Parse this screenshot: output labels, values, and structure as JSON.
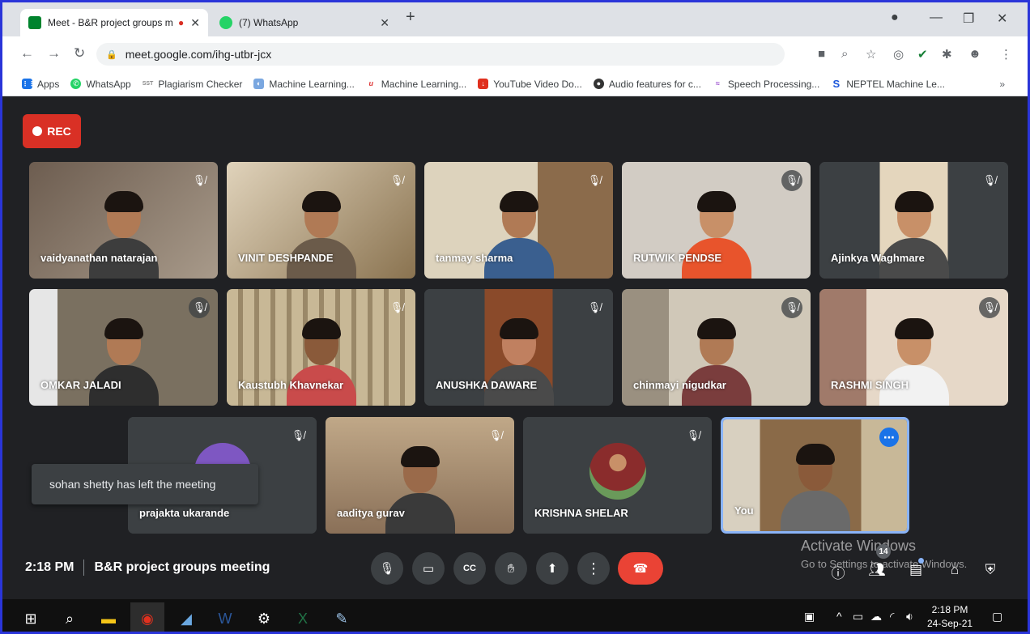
{
  "browser": {
    "tabs": [
      {
        "title": "Meet - B&R project groups m",
        "recording_dot": "●",
        "close": "✕"
      },
      {
        "title": "(7) WhatsApp",
        "close": "✕"
      }
    ],
    "new_tab": "+",
    "address": "meet.google.com/ihg-utbr-jcx",
    "bookmarks": [
      {
        "label": "Apps",
        "icon": "apps-grid-icon",
        "color": "#1a73e8",
        "glyph": "⋮⋮"
      },
      {
        "label": "WhatsApp",
        "icon": "whatsapp-icon",
        "color": "#25d366",
        "glyph": "✆"
      },
      {
        "label": "Plagiarism Checker",
        "icon": "sst-icon",
        "color": "#888888",
        "glyph": "SST"
      },
      {
        "label": "Machine Learning...",
        "icon": "ml-icon",
        "color": "#7aa7e0",
        "glyph": "◐"
      },
      {
        "label": "Machine Learning...",
        "icon": "udemy-icon",
        "color": "#d33",
        "glyph": "u"
      },
      {
        "label": "YouTube Video Do...",
        "icon": "download-icon",
        "color": "#e0301e",
        "glyph": "↓"
      },
      {
        "label": "Audio features for c...",
        "icon": "github-icon",
        "color": "#333333",
        "glyph": "●"
      },
      {
        "label": "Speech Processing...",
        "icon": "speech-icon",
        "color": "#9c4fcf",
        "glyph": "≈"
      },
      {
        "label": "NEPTEL Machine Le...",
        "icon": "s-icon",
        "color": "#1a56db",
        "glyph": "S"
      }
    ],
    "bookmarks_more": "»"
  },
  "meet": {
    "rec_label": "REC",
    "tiles_row1": [
      {
        "name": "vaidyanathan natarajan",
        "bg": "#7a6a5a",
        "shirt": "#3d3d3d"
      },
      {
        "name": "VINIT DESHPANDE",
        "bg": "#c9b79a",
        "shirt": "#6b5b4a"
      },
      {
        "name": "tanmay sharma",
        "bg": "#d8ceb8",
        "shirt": "#3a5f8f"
      },
      {
        "name": "RUTWIK PENDSE",
        "bg": "#cfc8c0",
        "shirt": "#e8542c"
      },
      {
        "name": "Ajinkya Waghmare",
        "bg": "#d7c6a8",
        "shirt": "#3c4043"
      }
    ],
    "tiles_row2": [
      {
        "name": "OMKAR JALADI",
        "bg": "#8a8070",
        "shirt": "#2e2e2e"
      },
      {
        "name": "Kaustubh Khavnekar",
        "bg": "#b6a88a",
        "shirt": "#c94b4b"
      },
      {
        "name": "ANUSHKA DAWARE",
        "bg": "#9b5a3a",
        "shirt": "#4a4a4a"
      },
      {
        "name": "chinmayi nigudkar",
        "bg": "#c8c0b0",
        "shirt": "#7a3d3d"
      },
      {
        "name": "RASHMI SINGH",
        "bg": "#e0cfc0",
        "shirt": "#f2f2f2"
      }
    ],
    "tiles_row3": [
      {
        "name": "prajakta ukarande",
        "bg": "#3c4043",
        "shirt": "#7e57c2"
      },
      {
        "name": "aaditya gurav",
        "bg": "#b59a80",
        "shirt": "#3a3a3a"
      },
      {
        "name": "KRISHNA SHELAR",
        "bg": "#3c4043",
        "shirt": "#8a2c2c"
      },
      {
        "name": "You",
        "bg": "#9a8060",
        "shirt": "#6a6a6a"
      }
    ],
    "toast": "sohan shetty has left the meeting",
    "time": "2:18 PM",
    "meeting_title": "B&R project groups meeting",
    "activate_line1": "Activate Windows",
    "activate_line2": "Go to Settings to activate Windows.",
    "participants_count": "14"
  },
  "taskbar": {
    "time": "2:18 PM",
    "date": "24-Sep-21"
  }
}
